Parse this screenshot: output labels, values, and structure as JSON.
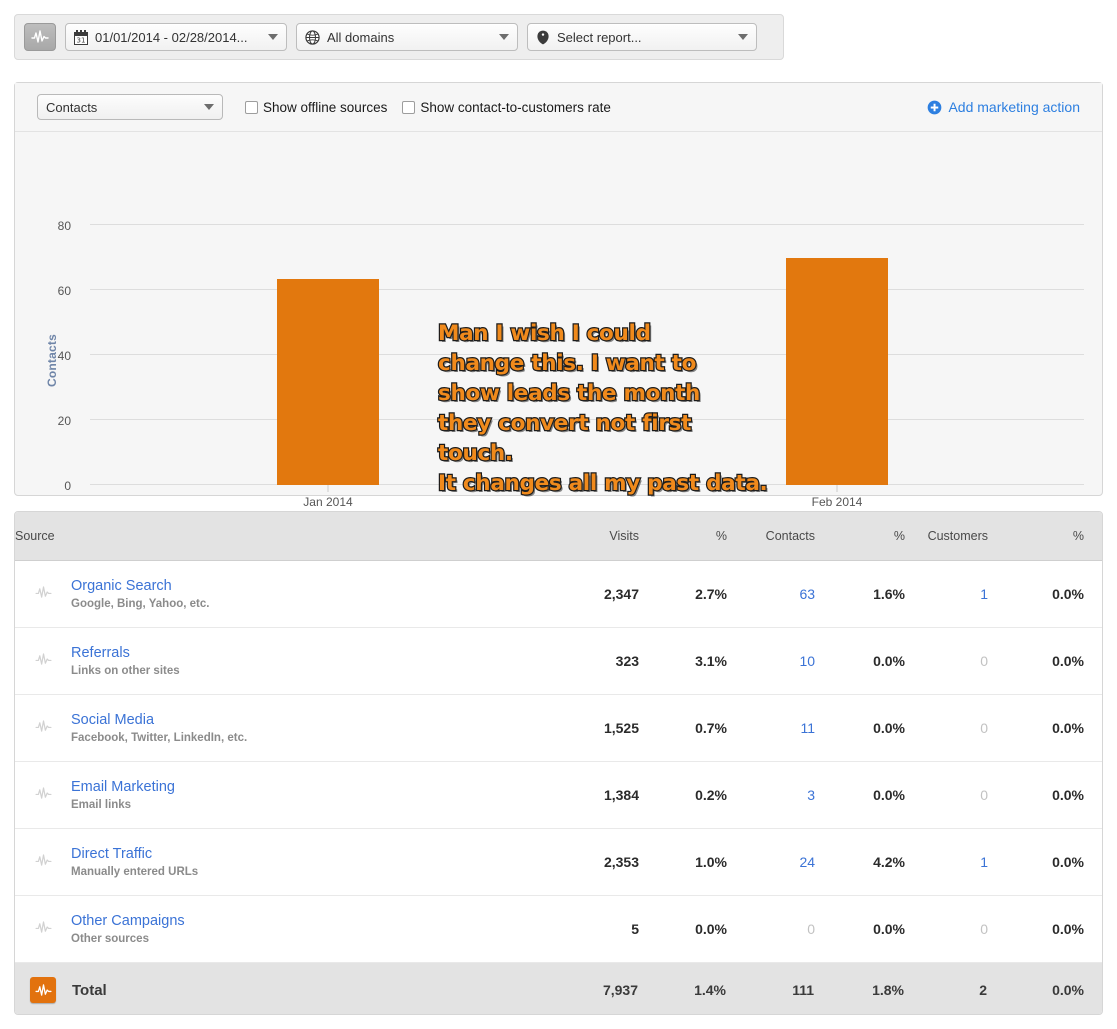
{
  "topbar": {
    "logo_icon": "pulse-icon",
    "date_range": {
      "icon": "calendar-icon",
      "value": "01/01/2014 - 02/28/2014..."
    },
    "domain": {
      "icon": "globe-icon",
      "value": "All domains"
    },
    "report": {
      "icon": "tag-icon",
      "value": "Select report..."
    }
  },
  "chart_toolbar": {
    "metric": "Contacts",
    "checkbox_offline": "Show offline sources",
    "checkbox_rate": "Show contact-to-customers rate",
    "add_action": "Add marketing action",
    "add_action_color": "#2d7fe0"
  },
  "annotation": {
    "text": "Man I wish I could\nchange this. I want to\nshow leads the month\nthey convert not first touch.\nIt changes all my past data.",
    "fill_color": "#F08A1C",
    "stroke_color": "#1a1a1a"
  },
  "chart_data": {
    "type": "bar",
    "title": "",
    "xlabel": "",
    "ylabel": "Contacts",
    "categories": [
      "Jan 2014",
      "Feb 2014"
    ],
    "values": [
      63,
      66
    ],
    "ylim": [
      0,
      88
    ],
    "yticks": [
      0,
      20,
      40,
      60,
      80
    ],
    "ytick_labels": [
      "0",
      "20",
      "40",
      "60",
      "80"
    ],
    "grid": true,
    "legend": "none",
    "series": [
      {
        "name": "Contacts",
        "values": [
          63,
          66
        ],
        "color": "#e2780e"
      }
    ],
    "markers": [
      "calendar-check-icon",
      "calendar-check-icon"
    ]
  },
  "table": {
    "columns": [
      "Source",
      "Visits",
      "%",
      "Contacts",
      "%",
      "Customers",
      "%"
    ],
    "swap_icon": "swap-arrows-icon",
    "rows": [
      {
        "icon": "pulse-icon",
        "name": "Organic Search",
        "desc": "Google, Bing, Yahoo, etc.",
        "visits": "2,347",
        "visits_pct": "2.7%",
        "contacts": "63",
        "contacts_link": true,
        "contacts_pct": "1.6%",
        "customers": "1",
        "customers_link": true,
        "customers_pct": "0.0%"
      },
      {
        "icon": "pulse-icon",
        "name": "Referrals",
        "desc": "Links on other sites",
        "visits": "323",
        "visits_pct": "3.1%",
        "contacts": "10",
        "contacts_link": true,
        "contacts_pct": "0.0%",
        "customers": "0",
        "customers_link": false,
        "customers_pct": "0.0%"
      },
      {
        "icon": "pulse-icon",
        "name": "Social Media",
        "desc": "Facebook, Twitter, LinkedIn, etc.",
        "visits": "1,525",
        "visits_pct": "0.7%",
        "contacts": "11",
        "contacts_link": true,
        "contacts_pct": "0.0%",
        "customers": "0",
        "customers_link": false,
        "customers_pct": "0.0%"
      },
      {
        "icon": "pulse-icon",
        "name": "Email Marketing",
        "desc": "Email links",
        "visits": "1,384",
        "visits_pct": "0.2%",
        "contacts": "3",
        "contacts_link": true,
        "contacts_pct": "0.0%",
        "customers": "0",
        "customers_link": false,
        "customers_pct": "0.0%"
      },
      {
        "icon": "pulse-icon",
        "name": "Direct Traffic",
        "desc": "Manually entered URLs",
        "visits": "2,353",
        "visits_pct": "1.0%",
        "contacts": "24",
        "contacts_link": true,
        "contacts_pct": "4.2%",
        "customers": "1",
        "customers_link": true,
        "customers_pct": "0.0%"
      },
      {
        "icon": "pulse-icon",
        "name": "Other Campaigns",
        "desc": "Other sources",
        "visits": "5",
        "visits_pct": "0.0%",
        "contacts": "0",
        "contacts_link": false,
        "contacts_pct": "0.0%",
        "customers": "0",
        "customers_link": false,
        "customers_pct": "0.0%"
      }
    ],
    "total": {
      "icon": "pulse-icon",
      "label": "Total",
      "visits": "7,937",
      "visits_pct": "1.4%",
      "contacts": "111",
      "contacts_pct": "1.8%",
      "customers": "2",
      "customers_pct": "0.0%"
    }
  }
}
